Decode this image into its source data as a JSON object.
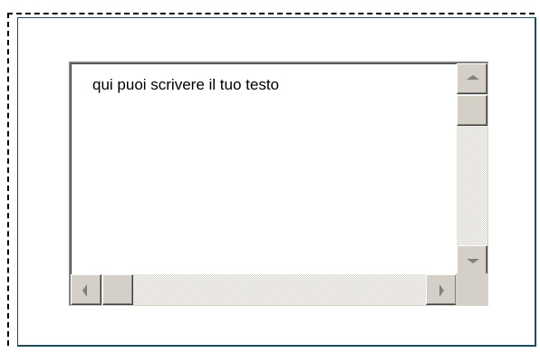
{
  "editor": {
    "text": "qui puoi scrivere il tuo testo"
  },
  "scrollbars": {
    "vertical": {
      "up_icon": "arrow-up-icon",
      "down_icon": "arrow-down-icon"
    },
    "horizontal": {
      "left_icon": "arrow-left-icon",
      "right_icon": "arrow-right-icon"
    }
  },
  "colors": {
    "frame_border": "#1e4d5a",
    "scrollbar_face": "#d4d0c8",
    "arrow": "#808080"
  }
}
